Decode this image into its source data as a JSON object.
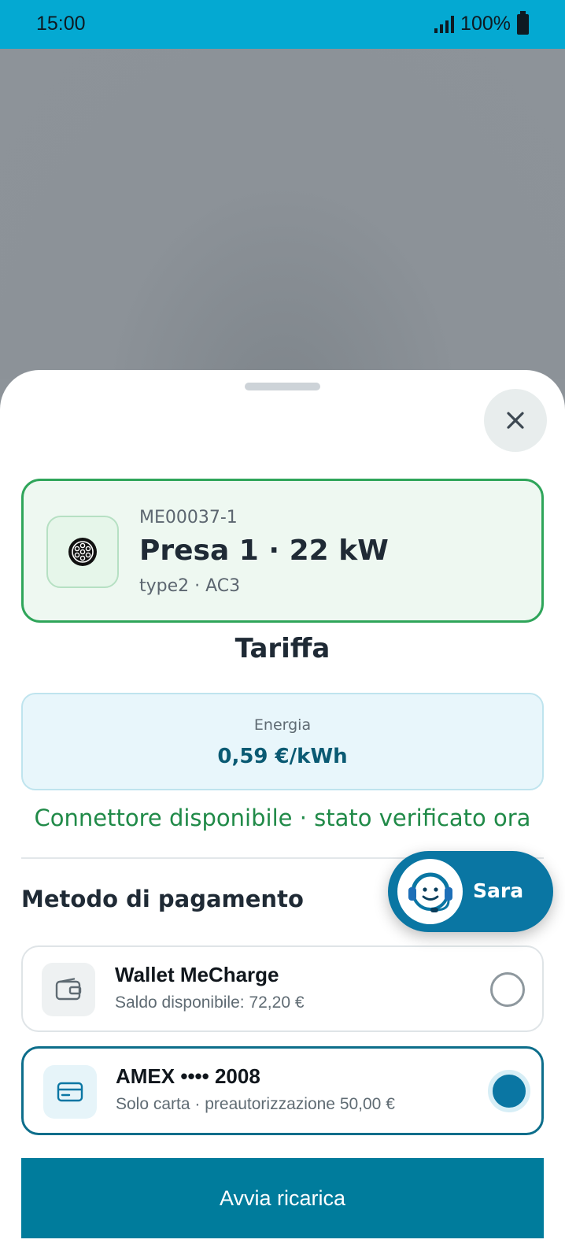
{
  "status_bar": {
    "time": "15:00",
    "battery": "100%"
  },
  "sheet": {
    "connector": {
      "id": "ME00037-1",
      "title": "Presa 1 · 22 kW",
      "type": "type2 · AC3"
    },
    "tariff": {
      "heading": "Tariffa",
      "label": "Energia",
      "price": "0,59 €/kWh"
    },
    "availability": "Connettore disponibile · stato verificato ora",
    "payment": {
      "heading": "Metodo di pagamento",
      "options": [
        {
          "title": "Wallet MeCharge",
          "subtitle": "Saldo disponibile: 72,20 €",
          "selected": false,
          "icon": "wallet-icon"
        },
        {
          "title": "AMEX •••• 2008",
          "subtitle": "Solo carta · preautorizzazione 50,00 €",
          "selected": true,
          "icon": "credit-card-icon"
        }
      ]
    },
    "start_button": "Avvia ricarica"
  },
  "assistant": {
    "name": "Sara",
    "icon": "support-agent-icon"
  },
  "colors": {
    "status_bar": "#04a9d2",
    "accent": "#007c9c",
    "available": "#2fa55a",
    "selected": "#0a76a3"
  }
}
